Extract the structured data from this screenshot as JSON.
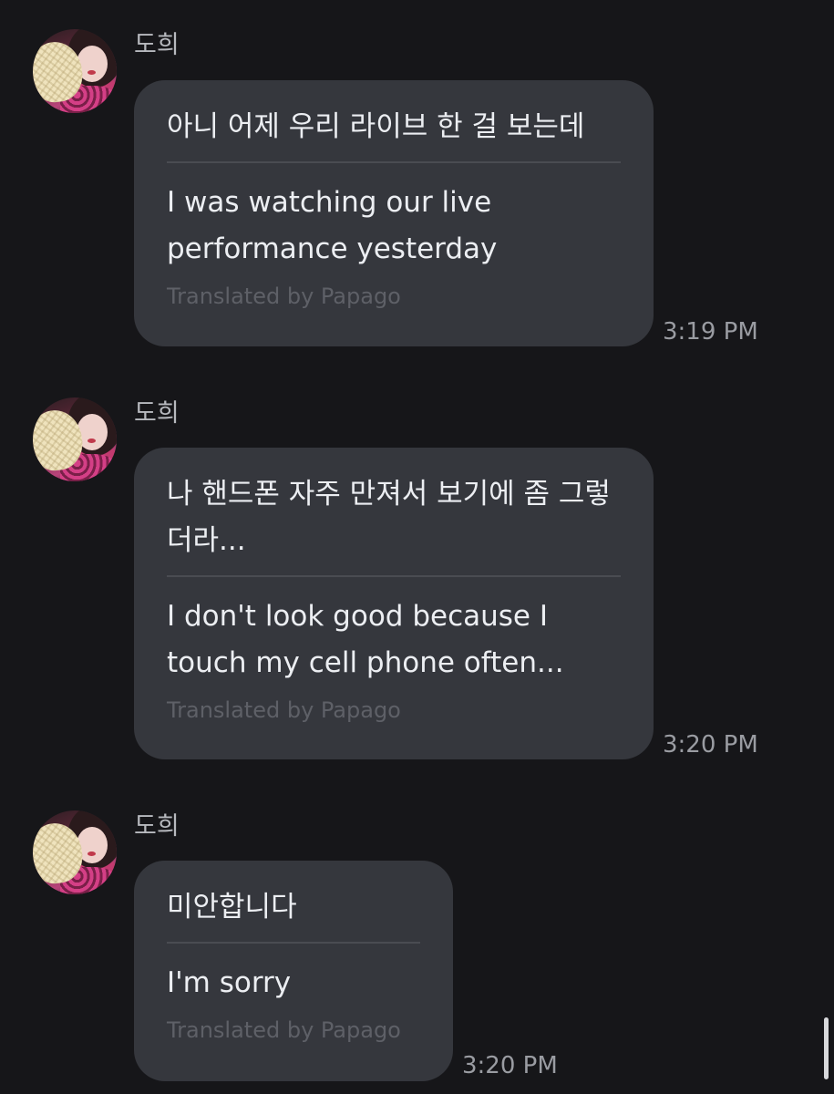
{
  "messages": [
    {
      "sender": "도희",
      "original": "아니 어제 우리 라이브 한 걸 보는데",
      "translated": "I was watching our live performance yesterday",
      "translation_credit": "Translated by Papago",
      "time": "3:19 PM"
    },
    {
      "sender": "도희",
      "original": "나 핸드폰 자주 만져서 보기에 좀 그렇더라...",
      "translated": "I don't look good because I touch my cell phone often...",
      "translation_credit": "Translated by Papago",
      "time": "3:20 PM"
    },
    {
      "sender": "도희",
      "original": "미안합니다",
      "translated": "I'm sorry",
      "translation_credit": "Translated by Papago",
      "time": "3:20 PM"
    }
  ],
  "icons": {
    "avatar": "profile-photo"
  }
}
